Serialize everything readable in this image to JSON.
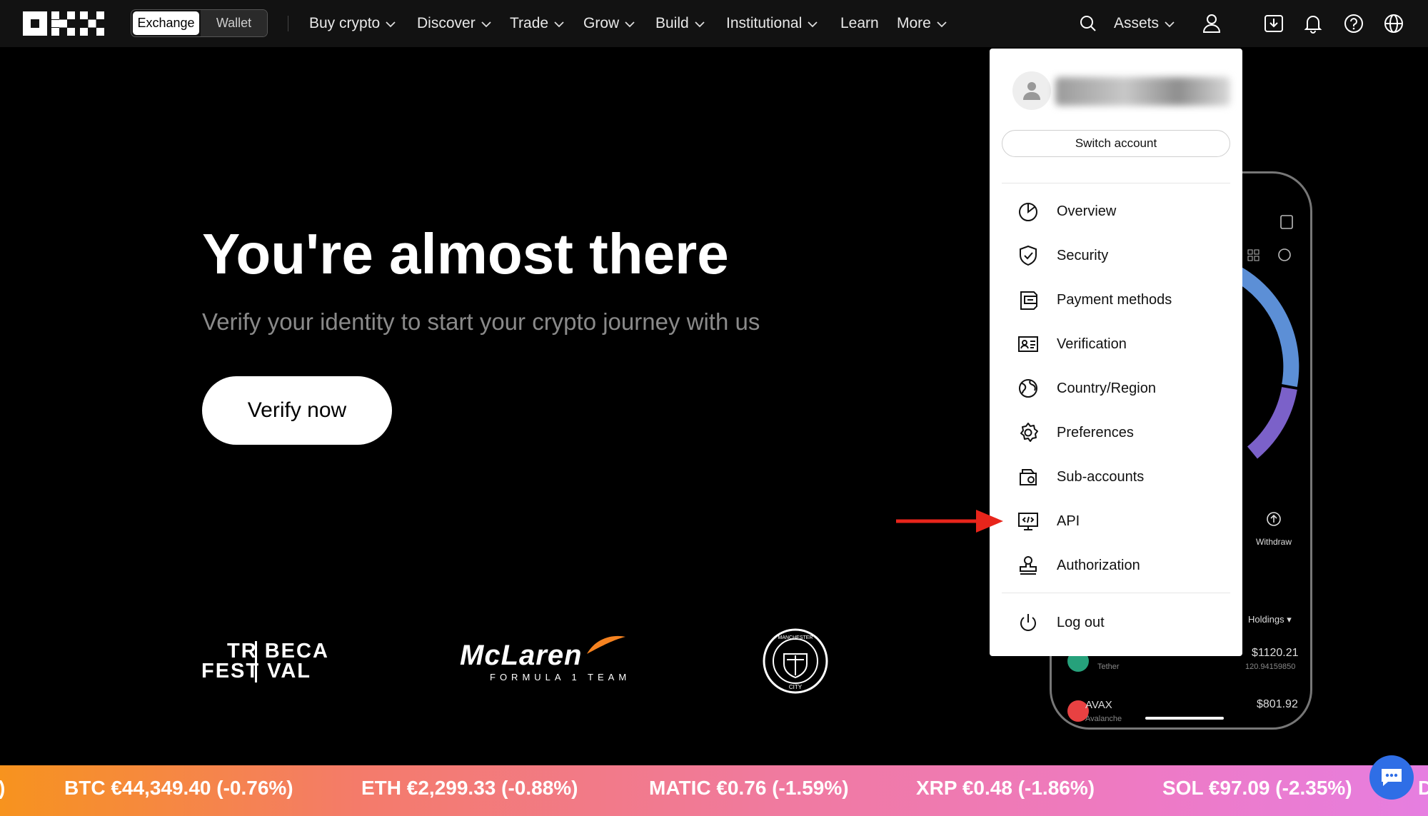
{
  "brand": {
    "name": "OKX"
  },
  "header": {
    "mode_toggle": {
      "exchange": "Exchange",
      "wallet": "Wallet",
      "active": "Exchange"
    },
    "nav": [
      "Buy crypto",
      "Discover",
      "Trade",
      "Grow",
      "Build",
      "Institutional",
      "Learn",
      "More"
    ],
    "assets_label": "Assets",
    "icons": [
      "search-icon",
      "user-icon",
      "download-icon",
      "bell-icon",
      "help-icon",
      "globe-icon"
    ]
  },
  "hero": {
    "title": "You're almost there",
    "subtitle": "Verify your identity to start your crypto journey with us",
    "cta": "Verify now"
  },
  "partners": {
    "tribeca": {
      "line1": "TR BECA",
      "line2": "FEST VAL"
    },
    "mclaren": {
      "word": "McLaren",
      "sub": "FORMULA 1 TEAM"
    },
    "mancity": {
      "top": "MANCHESTER",
      "bottom": "CITY"
    }
  },
  "phone": {
    "withdraw": "Withdraw",
    "holdings": "Holdings",
    "rows": [
      {
        "sub": "Tether",
        "value": "$1120.21",
        "amount": "120.94159850"
      },
      {
        "name": "AVAX",
        "sub": "Avalanche",
        "value": "$801.92"
      }
    ]
  },
  "account_menu": {
    "switch_account": "Switch account",
    "items": [
      {
        "label": "Overview",
        "icon": "pie-chart-icon"
      },
      {
        "label": "Security",
        "icon": "shield-icon"
      },
      {
        "label": "Payment methods",
        "icon": "wallet-card-icon"
      },
      {
        "label": "Verification",
        "icon": "id-card-icon"
      },
      {
        "label": "Country/Region",
        "icon": "globe-region-icon"
      },
      {
        "label": "Preferences",
        "icon": "gear-icon"
      },
      {
        "label": "Sub-accounts",
        "icon": "sub-accounts-icon"
      },
      {
        "label": "API",
        "icon": "api-icon"
      },
      {
        "label": "Authorization",
        "icon": "stamp-icon"
      }
    ],
    "logout": "Log out"
  },
  "ticker": [
    {
      "text": ")"
    },
    {
      "text": "BTC €44,349.40 (-0.76%)"
    },
    {
      "text": "ETH €2,299.33 (-0.88%)"
    },
    {
      "text": "MATIC €0.76 (-1.59%)"
    },
    {
      "text": "XRP €0.48 (-1.86%)"
    },
    {
      "text": "SOL €97.09 (-2.35%)"
    },
    {
      "text": "D"
    }
  ],
  "colors": {
    "accent_arrow": "#e8251b",
    "chat": "#2f6ee6"
  }
}
